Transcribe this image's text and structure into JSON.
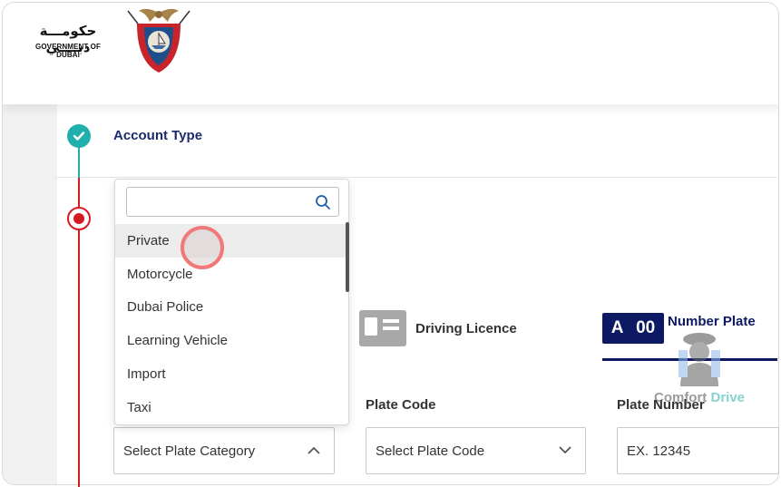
{
  "header": {
    "logo_arabic": "حكومـــة دبــــي",
    "logo_english": "GOVERNMENT OF DUBAI"
  },
  "steps": {
    "completed": {
      "label": "Account Type",
      "status": "done"
    },
    "current": {
      "status": "active"
    }
  },
  "dropdown": {
    "search_placeholder": "",
    "items": [
      {
        "label": "Private",
        "highlighted": true
      },
      {
        "label": "Motorcycle"
      },
      {
        "label": "Dubai Police"
      },
      {
        "label": "Learning Vehicle"
      },
      {
        "label": "Import"
      },
      {
        "label": "Taxi"
      }
    ]
  },
  "options": {
    "driving_licence": "Driving Licence",
    "plate_badge_letter": "A",
    "plate_badge_number": "00",
    "number_plate": "Number Plate"
  },
  "fields": {
    "plate_category": {
      "label": "",
      "value": "Select Plate Category"
    },
    "plate_code": {
      "label": "Plate Code",
      "value": "Select Plate Code"
    },
    "plate_number": {
      "label": "Plate Number",
      "placeholder": "EX. 12345"
    }
  },
  "watermark": {
    "word1": "Comfort",
    "word2": "Drive"
  },
  "colors": {
    "teal": "#1fb0ad",
    "red": "#d71920",
    "navy": "#0d1a63",
    "heading_navy": "#1b2a6b"
  },
  "icons": [
    "check-icon",
    "search-icon",
    "chevron-up-icon",
    "chevron-down-icon",
    "licence-card-icon",
    "emblem-icon"
  ]
}
